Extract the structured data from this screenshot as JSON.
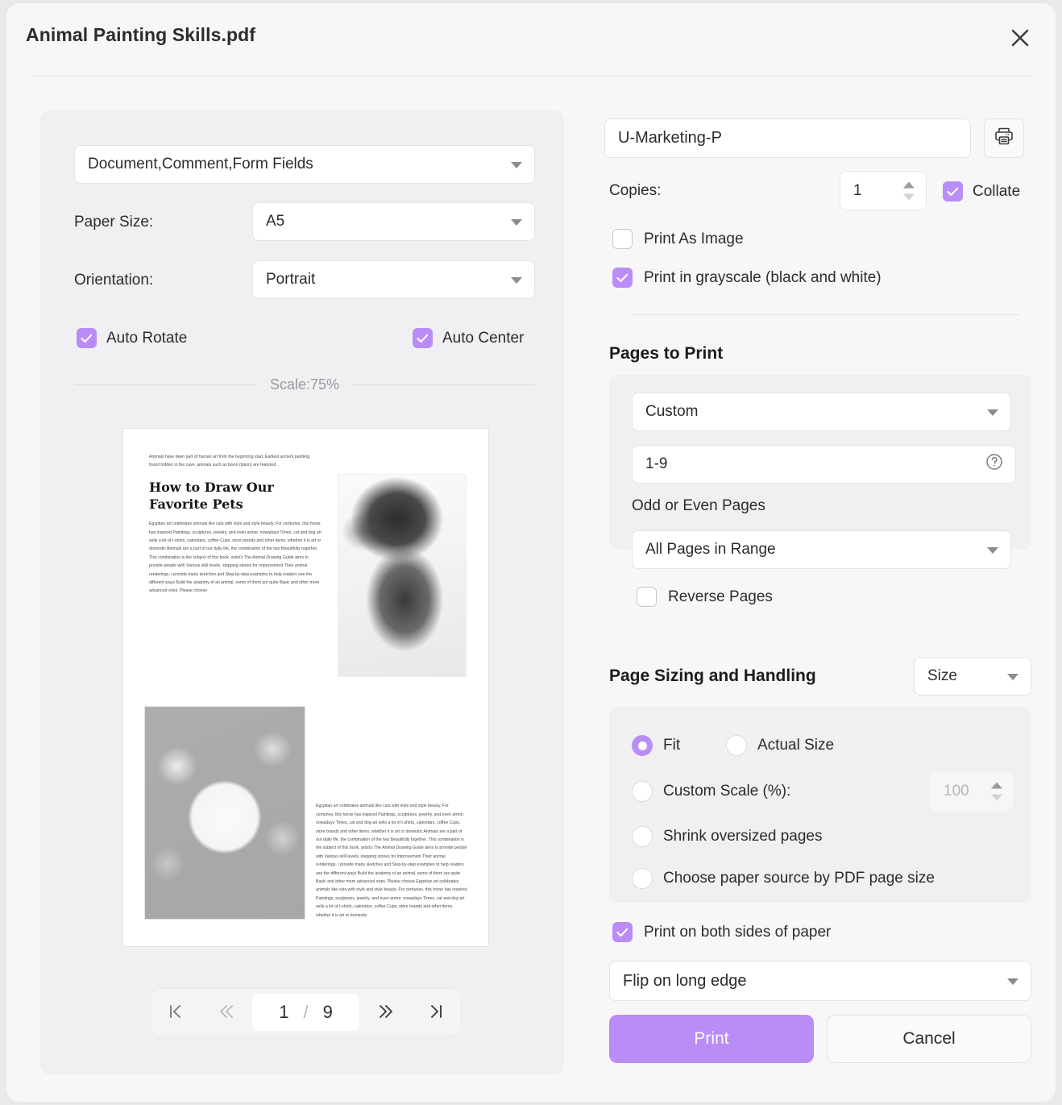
{
  "dialog": {
    "title": "Animal Painting Skills.pdf",
    "close_icon": "close-icon"
  },
  "colors": {
    "accent": "#b98cf7",
    "panel_bg": "#f0f0f2",
    "dialog_bg": "#f7f7f8",
    "text": "#2c2c2e"
  },
  "left": {
    "content_select": {
      "value": "Document,Comment,Form Fields"
    },
    "paper_size": {
      "label": "Paper Size:",
      "value": "A5"
    },
    "orientation": {
      "label": "Orientation:",
      "value": "Portrait"
    },
    "auto_rotate": {
      "label": "Auto Rotate",
      "checked": true
    },
    "auto_center": {
      "label": "Auto Center",
      "checked": true
    },
    "scale_text": "Scale:75%",
    "preview": {
      "intro": "Animals have been part of human art from the beginning start. Earliest ancient painting, found hidden in the cave, animals such as bison (bison) are featured. .",
      "heading": "How to Draw Our Favorite Pets",
      "body": "Egyptian art celebrates animals like cats with style and style beauty. For centuries, this horse has inspired Paintings, sculptures, jewelry, and even armor. nowadays Times, cat and dog art sells a lot of t-shirts, calendars, coffee Cups, store brands and other items. whether it is art or domestic Animals are a part of our daily life, the combination of the two Beautifully together. This combination is the subject of this book. artist's The Animal Drawing Guide aims to provide people with Various skill levels, stepping stones for improvement Their animal renderings. i provide many sketches and Step-by-step examples to help readers see the different ways Build the anatomy of an animal. some of them are quite Basic and other more advanced ones. Please choose",
      "right_column": "Egyptian art celebrates animals like cats with style and style beauty. For centuries, this horse has inspired Paintings, sculptures, jewelry, and even armor. nowadays Times, cat and dog art sells a lot of t-shirts, calendars, coffee Cups, store brands and other items. whether it is art or domestic Animals are a part of our daily life, the combination of the two Beautifully together. This combination is the subject of this book. artist's The Animal Drawing Guide aims to provide people with Various skill levels, stepping stones for improvement Their animal renderings. i provide many sketches and Step-by-step examples to help readers see the different ways Build the anatomy of an animal. some of them are quite Basic and other more advanced ones. Please choose Egyptian art celebrates animals like cats with style and style beauty. For centuries, this horse has inspired Paintings, sculptures, jewelry, and even armor. nowadays Times, cat and dog art sells a lot of t-shirts, calendars, coffee Cups, store brands and other items. whether it is art or domestic",
      "image_dog_sketch": "pencil-sketch-of-dog",
      "image_embroidery_hoop": "embroidery-hoop-dog-portrait-with-flowers"
    },
    "pager": {
      "first_icon": "first-page-icon",
      "prev_icon": "previous-page-icon",
      "current_page": "1",
      "separator": "/",
      "total_pages": "9",
      "next_icon": "next-page-icon",
      "last_icon": "last-page-icon"
    }
  },
  "right": {
    "printer": {
      "value": "U-Marketing-P",
      "properties_icon": "printer-icon"
    },
    "copies": {
      "label": "Copies:",
      "value": "1"
    },
    "collate": {
      "label": "Collate",
      "checked": true
    },
    "print_as_image": {
      "label": "Print As Image",
      "checked": false
    },
    "grayscale": {
      "label": "Print in grayscale (black and white)",
      "checked": true
    },
    "pages_to_print": {
      "title": "Pages to Print",
      "mode": "Custom",
      "range_value": "1-9",
      "help_icon": "help-icon",
      "odd_even_label": "Odd or Even Pages",
      "odd_even_value": "All Pages in Range",
      "reverse_pages": {
        "label": "Reverse Pages",
        "checked": false
      }
    },
    "page_sizing": {
      "title": "Page Sizing and Handling",
      "size_mode": "Size",
      "options": [
        {
          "label": "Fit",
          "selected": true
        },
        {
          "label": "Actual Size",
          "selected": false
        },
        {
          "label": "Custom Scale (%):",
          "selected": false
        },
        {
          "label": "Shrink oversized pages",
          "selected": false
        },
        {
          "label": "Choose paper source by PDF page size",
          "selected": false
        }
      ],
      "custom_scale_value": "100"
    },
    "both_sides": {
      "label": "Print on both sides of paper",
      "checked": true
    },
    "flip_mode": "Flip on long edge",
    "print_button": "Print",
    "cancel_button": "Cancel"
  }
}
